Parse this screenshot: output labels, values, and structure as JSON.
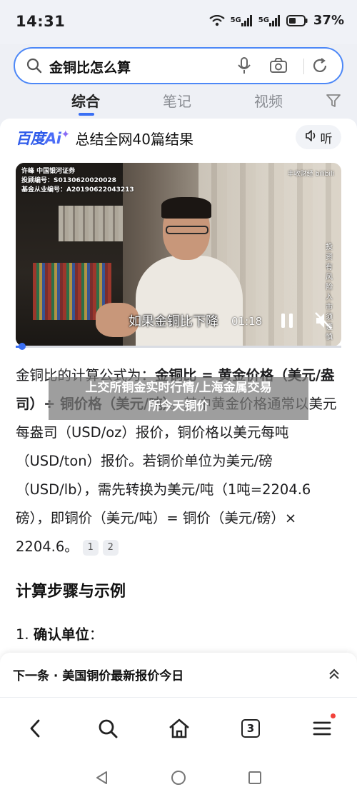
{
  "status_bar": {
    "time": "14:31",
    "signal1": "5G",
    "signal2": "5G",
    "battery": "37%"
  },
  "search": {
    "query": "金铜比怎么算"
  },
  "tabs": [
    {
      "label": "综合"
    },
    {
      "label": "笔记"
    },
    {
      "label": "视频"
    }
  ],
  "ai_summary": {
    "logo_main": "百度",
    "logo_ai": "Ai",
    "title": "总结全网40篇结果",
    "listen_label": "听"
  },
  "video": {
    "meta_line1": "许峰 中国银河证券",
    "meta_line2": "投顾编号：S0130620020028",
    "meta_line3": "基金从业编号：A20190622043213",
    "brand": "丰收财经 bilibili",
    "side_text": "投资有风险 入市须谨慎",
    "caption": "如果金铜比下降",
    "time": "01:18",
    "progress": 0.02
  },
  "answer": {
    "p1_prefix": "金铜比的计算公式为：",
    "p1_formula": "金铜比 = 黄金价格（美元/盎司）÷ 铜价格（美元/吨）",
    "p1_rest": "。其中黄金价格通常以美元每盎司（USD/oz）报价，铜价格以美元每吨（USD/ton）报价。若铜价单位为美元/磅（USD/lb），需先转换为美元/吨（1吨=2204.6磅），即铜价（美元/吨）= 铜价（美元/磅）× 2204.6。",
    "ref1": "1",
    "ref2": "2",
    "section_title": "计算步骤与示例",
    "step1_num": "1.",
    "step1_label": "确认单位",
    "step1_colon": "："
  },
  "overlay": {
    "line1": "上交所铜金实时行情/上海金属交易",
    "line2": "所今天铜价"
  },
  "next_bar": {
    "text": "下一条 · 美国铜价最新报价今日"
  },
  "bottom_nav": {
    "tab_count": "3"
  }
}
